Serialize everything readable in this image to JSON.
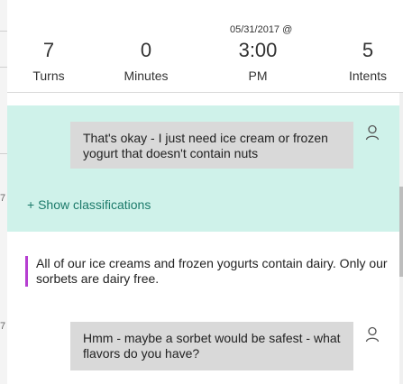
{
  "background_marks": [
    "7",
    "7"
  ],
  "header": {
    "close_icon": "close-icon",
    "date": "05/31/2017 @",
    "stats": [
      {
        "value": "7",
        "label": "Turns"
      },
      {
        "value": "0",
        "label": "Minutes"
      },
      {
        "value": "3:00",
        "label": "PM"
      },
      {
        "value": "5",
        "label": "Intents"
      }
    ]
  },
  "conversation": {
    "messages": [
      {
        "role": "user",
        "text": "That's okay - I just need ice cream or frozen yogurt that doesn't contain nuts"
      },
      {
        "role": "bot",
        "text": "All of our ice creams and frozen yogurts contain dairy. Only our sorbets are dairy free."
      },
      {
        "role": "user",
        "text": "Hmm - maybe a sorbet would be safest - what flavors do you have?"
      }
    ],
    "show_classifications": "+ Show classifications"
  },
  "colors": {
    "highlight": "#cff2ea",
    "user_bubble": "#d9d9d9",
    "bot_accent": "#b63fd1",
    "link": "#1c7a6a"
  }
}
